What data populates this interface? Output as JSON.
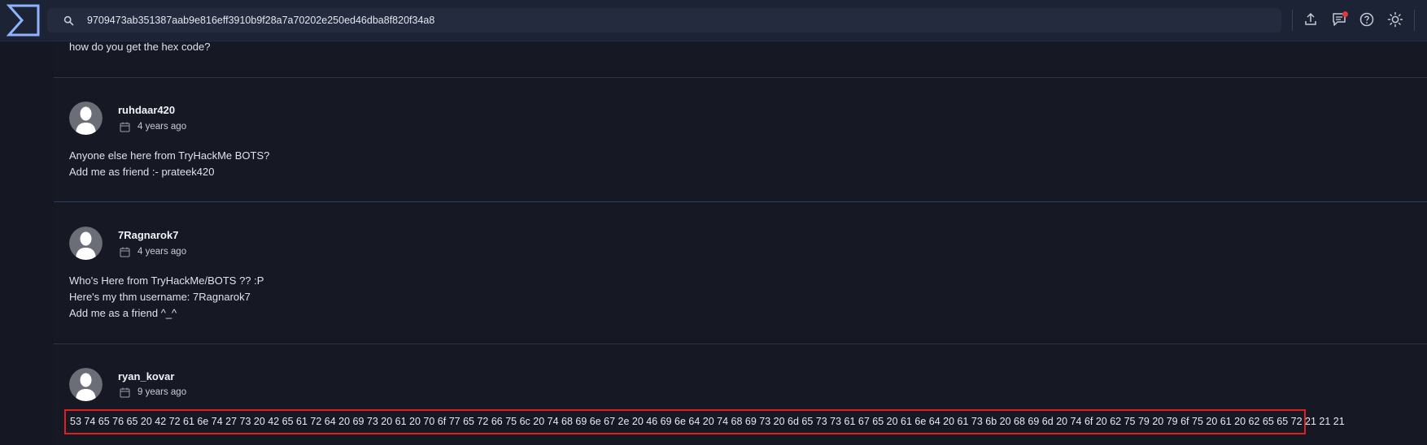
{
  "topbar": {
    "search_value": "9709473ab351387aab9e816eff3910b9f28a7a70202e250ed46dba8f820f34a8",
    "icons": [
      "logo-icon",
      "search-icon",
      "upload-icon",
      "chat-icon",
      "help-icon",
      "theme-icon"
    ],
    "notification_color": "#e8353b"
  },
  "partial_comment": {
    "body": "how do you get the hex code?"
  },
  "comments": [
    {
      "username": "ruhdaar420",
      "time": "4 years ago",
      "lines": [
        "Anyone else here from TryHackMe BOTS?",
        "Add me as friend :- prateek420"
      ]
    },
    {
      "username": "7Ragnarok7",
      "time": "4 years ago",
      "lines": [
        "Who's Here from TryHackMe/BOTS ?? :P",
        "Here's my thm username: 7Ragnarok7",
        "Add me as a friend ^_^"
      ]
    },
    {
      "username": "ryan_kovar",
      "time": "9 years ago",
      "lines": [
        "53 74 65 76 65 20 42 72 61 6e 74 27 73 20 42 65 61 72 64 20 69 73 20 61 20 70 6f 77 65 72 66 75 6c 20 74 68 69 6e 67 2e 20 46 69 6e 64 20 74 68 69 73 20 6d 65 73 73 61 67 65 20 61 6e 64 20 61 73 6b 20 68 69 6d 20 74 6f 20 62 75 79 20 79 6f 75 20 61 20 62 65 65 72 21 21 21"
      ]
    }
  ],
  "colors": {
    "background": "#161824",
    "topbar": "#1c2334",
    "highlight_border": "#e02020",
    "accent": "#8fb3ff"
  }
}
